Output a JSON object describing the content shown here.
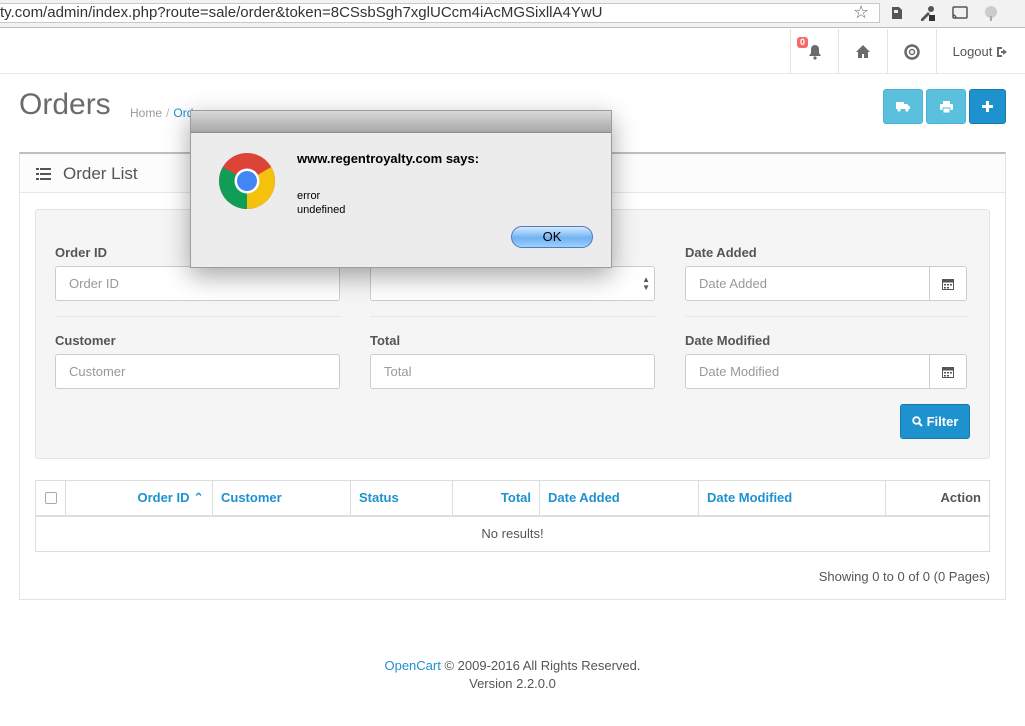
{
  "browser": {
    "url": "ty.com/admin/index.php?route=sale/order&token=8CSsbSgh7xglUCcm4iAcMGSixllA4YwU"
  },
  "header": {
    "notification_count": "0",
    "logout_label": "Logout"
  },
  "page": {
    "title": "Orders",
    "breadcrumb": [
      {
        "label": "Home"
      },
      {
        "label": "Ord"
      }
    ]
  },
  "panel": {
    "title": "Order List"
  },
  "filters": {
    "order_id_label": "Order ID",
    "order_id_placeholder": "Order ID",
    "date_added_label": "Date Added",
    "date_added_placeholder": "Date Added",
    "customer_label": "Customer",
    "customer_placeholder": "Customer",
    "total_label": "Total",
    "total_placeholder": "Total",
    "date_modified_label": "Date Modified",
    "date_modified_placeholder": "Date Modified",
    "filter_button": "Filter"
  },
  "table": {
    "columns": [
      {
        "label": "Order ID ⌃"
      },
      {
        "label": "Customer"
      },
      {
        "label": "Status"
      },
      {
        "label": "Total"
      },
      {
        "label": "Date Added"
      },
      {
        "label": "Date Modified"
      },
      {
        "label": "Action"
      }
    ],
    "empty_message": "No results!",
    "pagination_text": "Showing 0 to 0 of 0 (0 Pages)"
  },
  "footer": {
    "brand": "OpenCart",
    "copyright": " © 2009-2016 All Rights Reserved.",
    "version": "Version 2.2.0.0"
  },
  "dialog": {
    "title": "www.regentroyalty.com says:",
    "line1": "error",
    "line2": "undefined",
    "ok_label": "OK"
  },
  "colors": {
    "accent": "#1e91cf",
    "info": "#5bc0de",
    "badge": "#f56b6b"
  }
}
